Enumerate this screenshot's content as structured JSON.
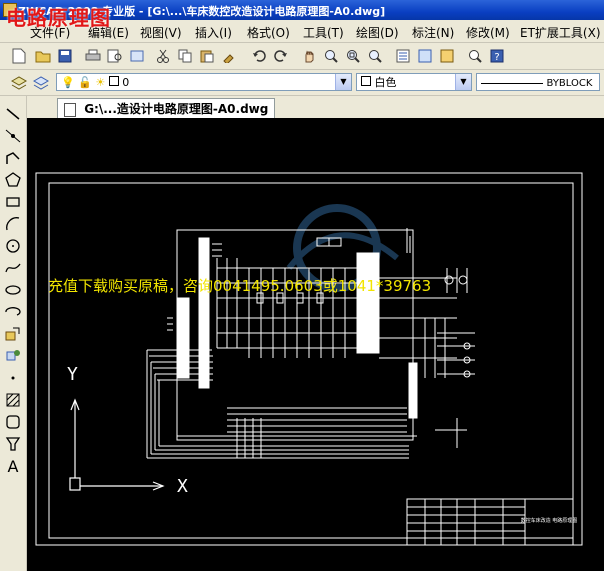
{
  "app": {
    "window_title": "ZWCAD 2008 专业版 - [G:\\...\\车床数控改造设计电路原理图-A0.dwg]",
    "overlay_title": "电路原理图"
  },
  "menu": {
    "items": [
      "文件(F)",
      "编辑(E)",
      "视图(V)",
      "插入(I)",
      "格式(O)",
      "工具(T)",
      "绘图(D)",
      "标注(N)",
      "修改(M)",
      "ET扩展工具(X)"
    ]
  },
  "layer_toolbar": {
    "layer_value": "0",
    "color_value": "白色",
    "linetype_value": "BYBLOCK"
  },
  "document": {
    "tab_label": "G:\\...造设计电路原理图-A0.dwg"
  },
  "canvas": {
    "watermark_text": "充值下载购买原稿，咨询0041495.0603或1041*39763",
    "ucs_y_label": "Y",
    "ucs_x_label": "X",
    "title_block_text": "数控车床改造 电路原理图"
  },
  "colors": {
    "titlebar": "#0a3fc2",
    "canvas_bg": "#000000",
    "watermark": "#f2e500",
    "overlay_title": "#e21818"
  },
  "icons": {
    "standard_toolbar": [
      "new-icon",
      "open-icon",
      "save-icon",
      "print-icon",
      "preview-icon",
      "publish-icon",
      "cut-icon",
      "copy-icon",
      "paste-icon",
      "match-properties-icon",
      "undo-icon",
      "redo-icon",
      "pan-icon",
      "zoom-realtime-icon",
      "zoom-window-icon",
      "zoom-previous-icon",
      "properties-icon",
      "design-center-icon",
      "tool-palette-icon",
      "help-icon"
    ],
    "draw_toolbar": [
      "line-icon",
      "construction-line-icon",
      "polyline-icon",
      "polygon-icon",
      "rectangle-icon",
      "arc-icon",
      "circle-icon",
      "spline-icon",
      "ellipse-icon",
      "ellipse-arc-icon",
      "insert-block-icon",
      "make-block-icon",
      "point-icon",
      "hatch-icon",
      "region-icon",
      "table-icon",
      "text-icon"
    ]
  }
}
